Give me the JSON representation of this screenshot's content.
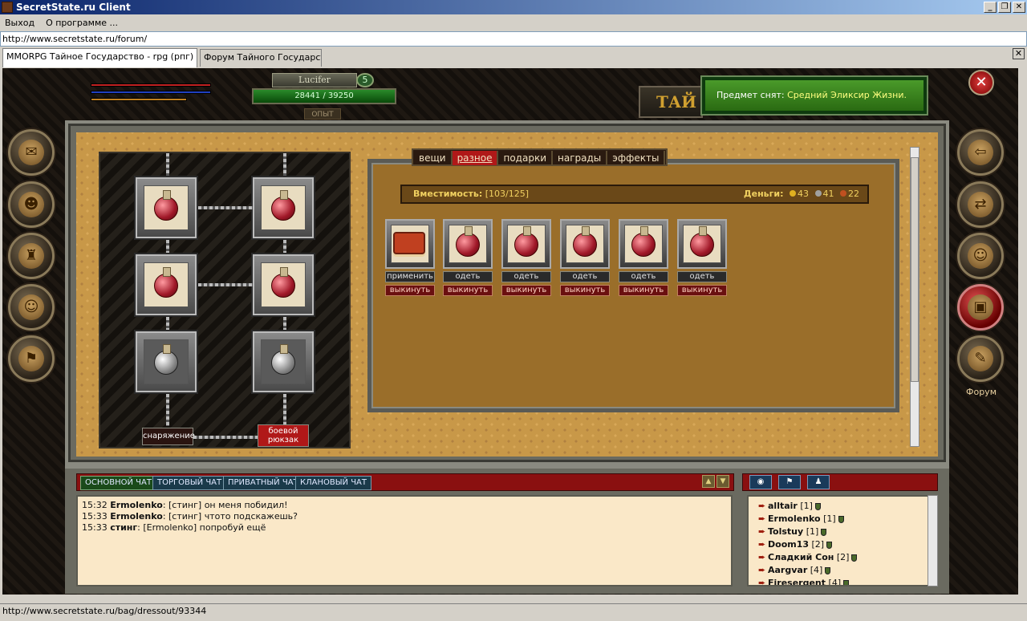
{
  "window": {
    "title": "SecretState.ru Client"
  },
  "menu": {
    "items": [
      "Выход",
      "О программе ..."
    ]
  },
  "url": "http://www.secretstate.ru/forum/",
  "tabs": [
    {
      "label": "MMORPG Тайное Государство - rpg (рпг) бр ..."
    },
    {
      "label": "Форум Тайного Государства"
    }
  ],
  "status_url": "http://www.secretstate.ru/bag/dressout/93344",
  "hud": {
    "nick": "Lucifer",
    "level": "5",
    "exp_current": "28441",
    "exp_sep": "/",
    "exp_max": "39250",
    "exp_label": "ОПЫТ",
    "secret_label": "ТАЙ",
    "colors": {
      "hp": "#c02020",
      "mana": "#2040c0",
      "stamina": "#c08020"
    }
  },
  "notice": {
    "prefix": "Предмет снят:",
    "item": "Средний Эликсир Жизни."
  },
  "equipment": {
    "btn_gear": "снаряжение",
    "btn_backpack": "боевой рюкзак"
  },
  "inventory": {
    "tabs": [
      "вещи",
      "разное",
      "подарки",
      "награды",
      "эффекты"
    ],
    "active_tab": "разное",
    "capacity_label": "Вместимость:",
    "capacity_value": "[103/125]",
    "money_label": "Деньги:",
    "money": {
      "gold": "43",
      "silver": "41",
      "copper": "22"
    },
    "items": [
      {
        "icon": "book-icon",
        "action": "применить",
        "drop": "выкинуть"
      },
      {
        "icon": "potion-icon",
        "action": "одеть",
        "drop": "выкинуть"
      },
      {
        "icon": "potion-icon",
        "action": "одеть",
        "drop": "выкинуть"
      },
      {
        "icon": "potion-icon",
        "action": "одеть",
        "drop": "выкинуть"
      },
      {
        "icon": "potion-icon",
        "action": "одеть",
        "drop": "выкинуть"
      },
      {
        "icon": "potion-icon",
        "action": "одеть",
        "drop": "выкинуть"
      }
    ]
  },
  "right_nav": {
    "forum_label": "Форум"
  },
  "chat": {
    "tabs": [
      "ОСНОВНОЙ ЧАТ",
      "ТОРГОВЫЙ ЧАТ",
      "ПРИВАТНЫЙ ЧАТ",
      "КЛАНОВЫЙ ЧАТ"
    ],
    "messages": [
      {
        "time": "15:32",
        "from": "Ermolenko",
        "to": "[стинг]",
        "text": "он меня побидил!"
      },
      {
        "time": "15:33",
        "from": "Ermolenko",
        "to": "[стинг]",
        "text": "чтото подскажешь?"
      },
      {
        "time": "15:33",
        "from": "стинг",
        "to": "[Ermolenko]",
        "text": "попробуй ещё"
      }
    ]
  },
  "users": [
    {
      "name": "alltair",
      "level": "[1]"
    },
    {
      "name": "Ermolenko",
      "level": "[1]"
    },
    {
      "name": "Tolstuy",
      "level": "[1]"
    },
    {
      "name": "Doom13",
      "level": "[2]"
    },
    {
      "name": "Сладкий Сон",
      "level": "[2]"
    },
    {
      "name": "Aargvar",
      "level": "[4]"
    },
    {
      "name": "Firesergent",
      "level": "[4]"
    }
  ]
}
